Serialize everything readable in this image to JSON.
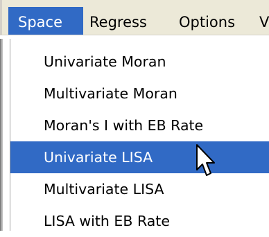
{
  "menubar": {
    "items": [
      {
        "label": "Space",
        "active": true
      },
      {
        "label": "Regress",
        "active": false
      },
      {
        "label": "Options",
        "active": false
      },
      {
        "label": "V",
        "active": false
      }
    ]
  },
  "dropdown": {
    "items": [
      {
        "label": "Univariate Moran",
        "highlighted": false
      },
      {
        "label": "Multivariate Moran",
        "highlighted": false
      },
      {
        "label": "Moran's I with EB Rate",
        "highlighted": false
      },
      {
        "label": "Univariate LISA",
        "highlighted": true
      },
      {
        "label": "Multivariate LISA",
        "highlighted": false
      },
      {
        "label": "LISA with EB Rate",
        "highlighted": false
      }
    ]
  },
  "colors": {
    "highlight": "#316ac5",
    "menubar_bg": "#ece9d8"
  },
  "cursor": {
    "icon": "arrow-pointer-icon"
  }
}
